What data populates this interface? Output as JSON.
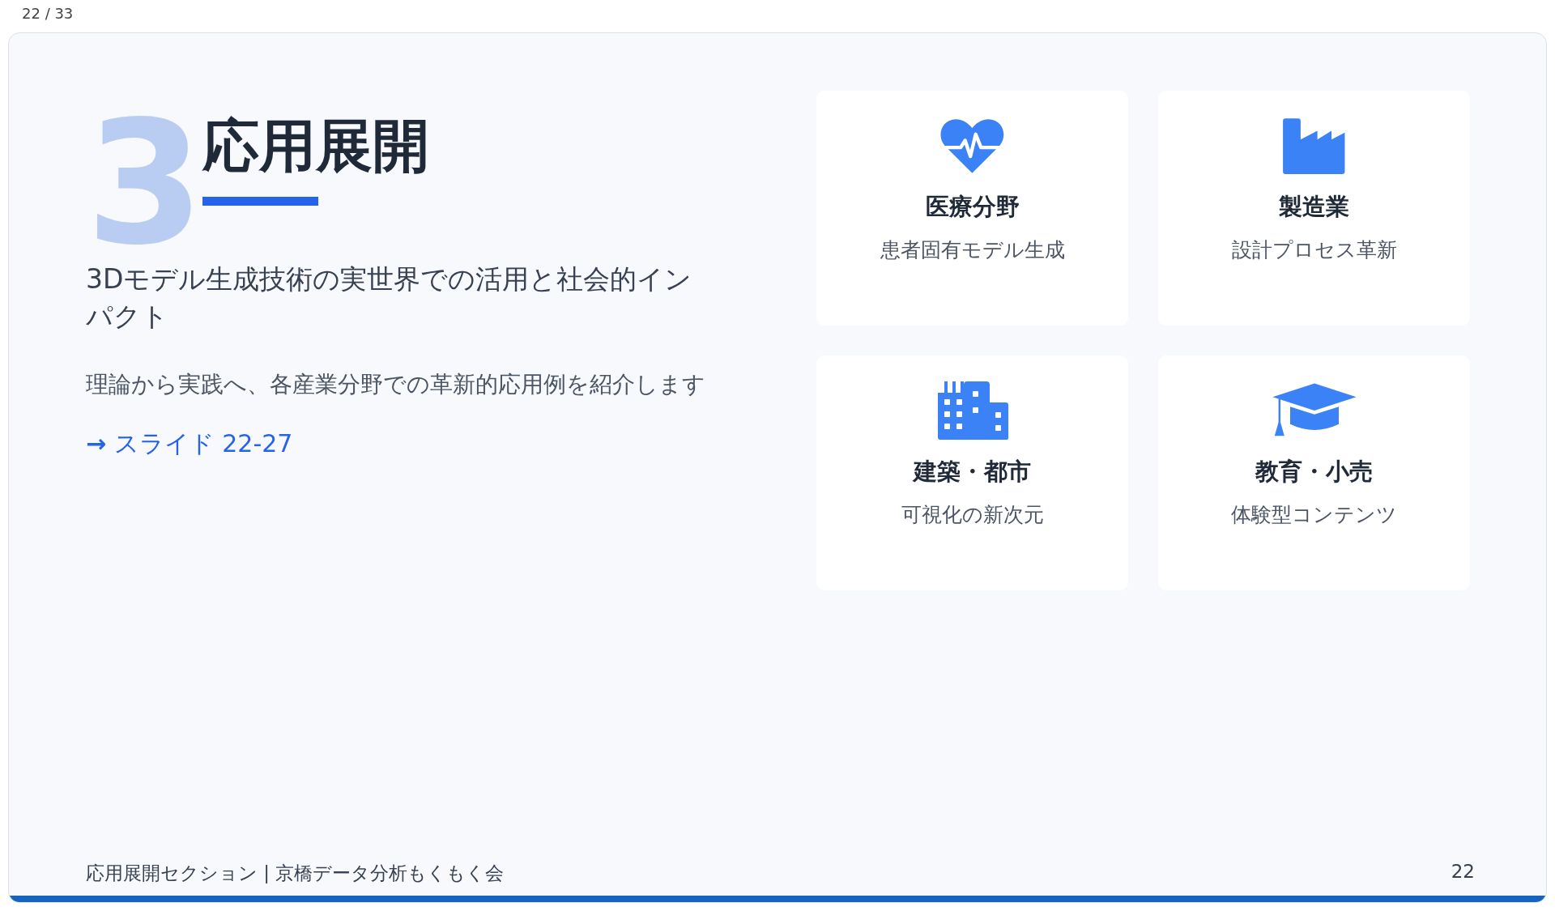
{
  "counter": "22 / 33",
  "slide": {
    "section_number": "3",
    "title": "応用展開",
    "subtitle": "3Dモデル生成技術の実世界での活用と社会的インパクト",
    "description": "理論から実践へ、各産業分野での革新的応用例を紹介します",
    "link": {
      "arrow": "→",
      "text": "スライド 22-27"
    },
    "cards": [
      {
        "kind": "heart-pulse",
        "title": "医療分野",
        "text": "患者固有モデル生成"
      },
      {
        "kind": "factory",
        "title": "製造業",
        "text": "設計プロセス革新"
      },
      {
        "kind": "buildings",
        "title": "建築・都市",
        "text": "可視化の新次元"
      },
      {
        "kind": "graduation-cap",
        "title": "教育・小売",
        "text": "体験型コンテンツ"
      }
    ],
    "footer": {
      "text": "応用展開セクション | 京橋データ分析もくもく会",
      "page": "22"
    }
  }
}
